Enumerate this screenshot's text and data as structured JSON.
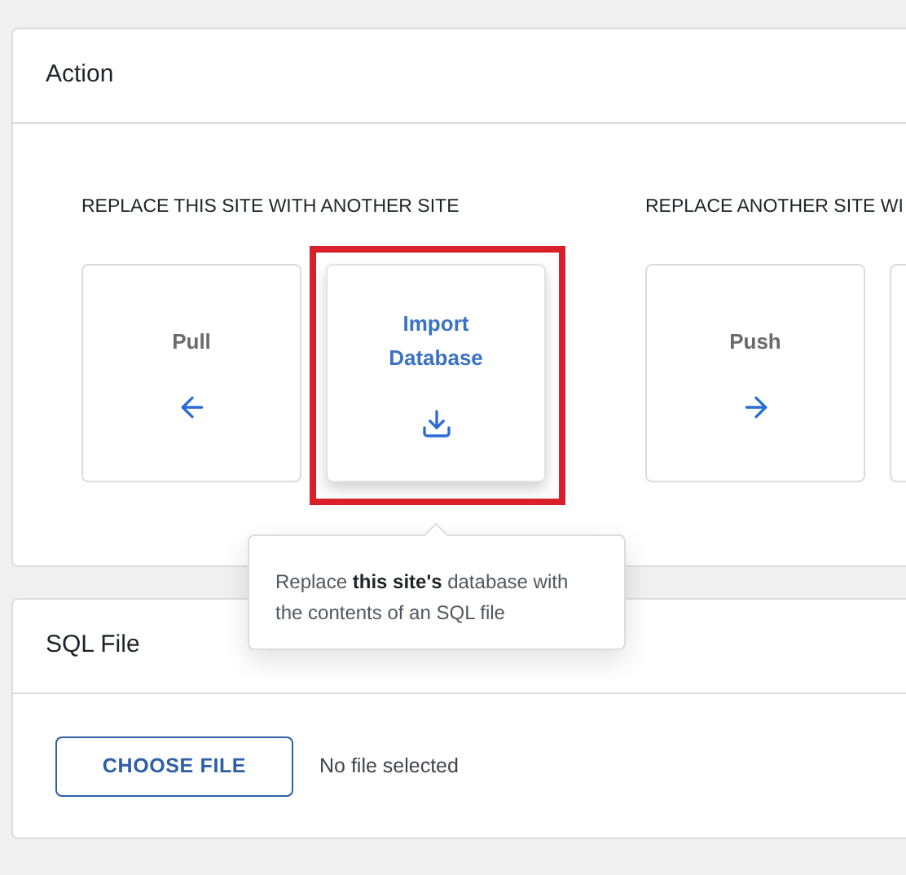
{
  "action_panel": {
    "title": "Action",
    "groups": [
      {
        "label": "REPLACE THIS SITE WITH ANOTHER SITE",
        "items": [
          {
            "label": "Pull",
            "kind": "pull",
            "selected": false
          },
          {
            "label": "Import Database",
            "kind": "import",
            "selected": true
          }
        ]
      },
      {
        "label": "REPLACE ANOTHER SITE WI",
        "items": [
          {
            "label": "Push",
            "kind": "push",
            "selected": false
          }
        ]
      }
    ]
  },
  "tooltip": {
    "text": "Replace **this site's** database with the contents of an SQL file"
  },
  "sql_panel": {
    "title": "SQL File",
    "button": "CHOOSE FILE",
    "status": "No file selected"
  }
}
